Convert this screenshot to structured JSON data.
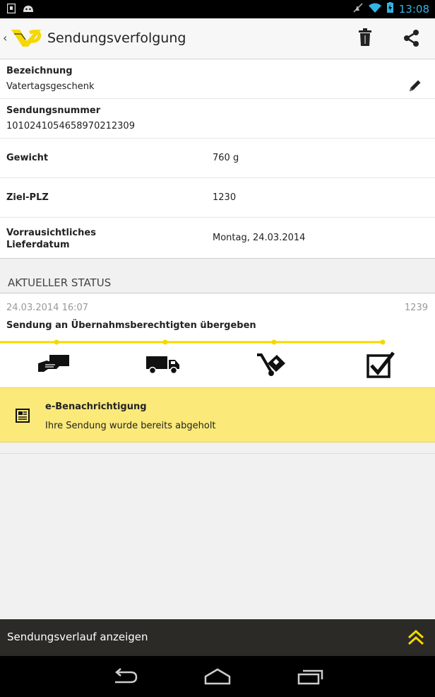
{
  "status_bar": {
    "time": "13:08"
  },
  "action_bar": {
    "back": "‹",
    "title": "Sendungsverfolgung"
  },
  "details": {
    "bezeichnung_label": "Bezeichnung",
    "bezeichnung_value": "Vatertagsgeschenk",
    "sendungsnummer_label": "Sendungsnummer",
    "sendungsnummer_value": "1010241054658970212309",
    "gewicht_label": "Gewicht",
    "gewicht_value": "760 g",
    "plz_label": "Ziel-PLZ",
    "plz_value": "1230",
    "liefer_label_1": "Vorrausichtliches",
    "liefer_label_2": "Lieferdatum",
    "liefer_value": "Montag, 24.03.2014"
  },
  "status": {
    "header": "AKTUELLER STATUS",
    "date": "24.03.2014 16:07",
    "code": "1239",
    "text": "Sendung an Übernahmsberechtigten übergeben",
    "progress_fraction": 0.88,
    "steps": [
      "handover-icon",
      "truck-icon",
      "hand-truck-icon",
      "checkbox-checked-icon"
    ]
  },
  "notification": {
    "title": "e-Benachrichtigung",
    "text": "Ihre Sendung wurde bereits abgeholt"
  },
  "bottom_bar": {
    "label": "Sendungsverlauf anzeigen"
  },
  "colors": {
    "accent": "#f5d800",
    "status_blue": "#33b5e5",
    "notify_bg": "#fbe97a"
  }
}
